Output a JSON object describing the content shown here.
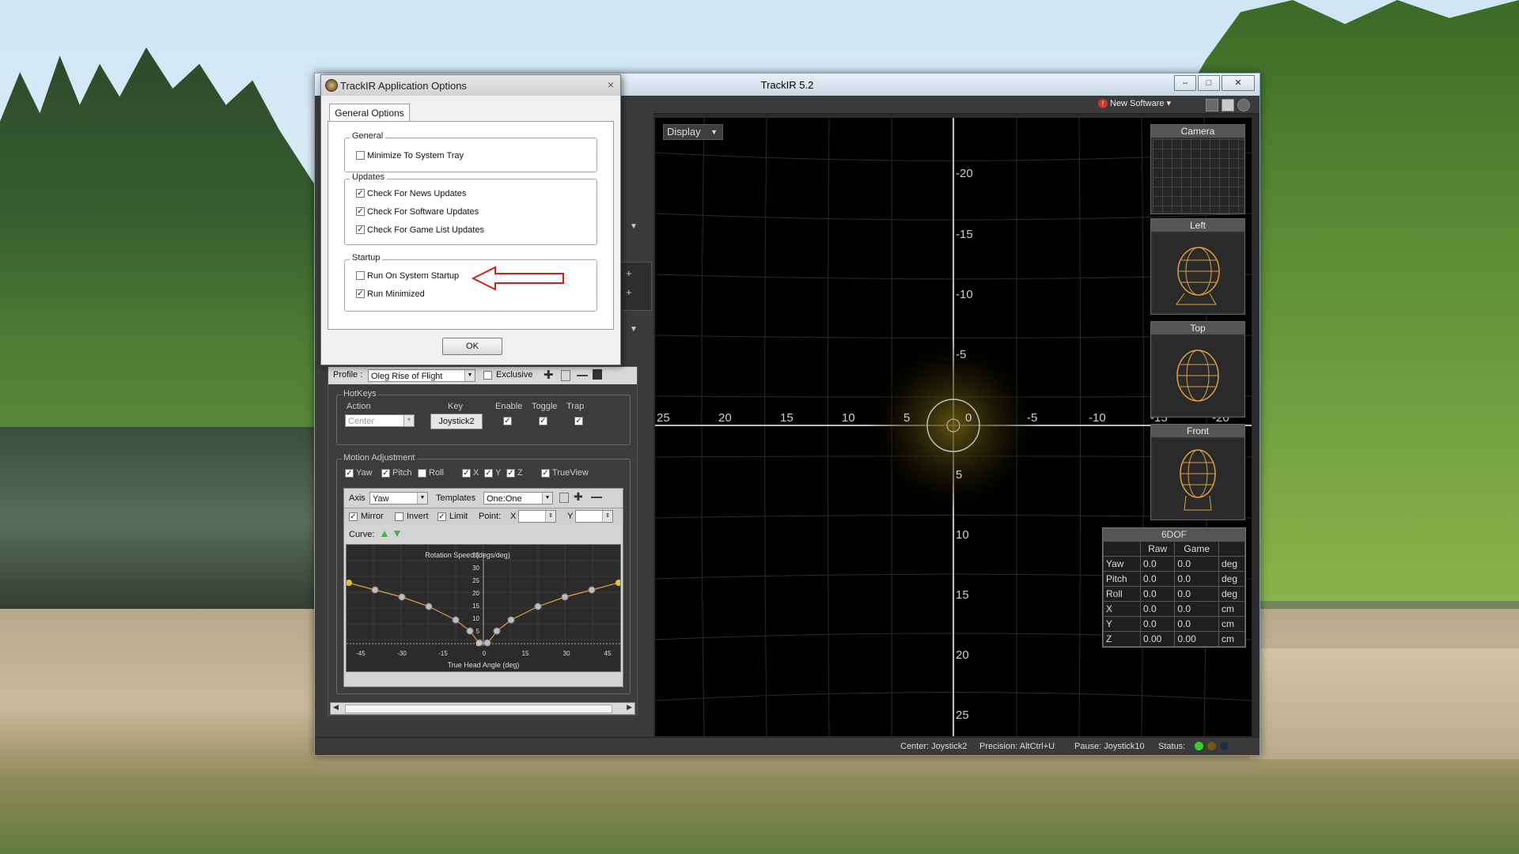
{
  "main_window": {
    "title": "TrackIR 5.2",
    "new_software": "New Software",
    "display_button": "Display",
    "minimize_glyph": "–",
    "maximize_glyph": "□",
    "close_glyph": "✕"
  },
  "view": {
    "x_ticks": [
      "25",
      "20",
      "15",
      "10",
      "5",
      "0",
      "-5",
      "-10",
      "-15",
      "-20"
    ],
    "y_ticks": [
      "-20",
      "-15",
      "-10",
      "-5",
      "5",
      "10",
      "15",
      "20",
      "25"
    ]
  },
  "panels": {
    "camera": "Camera",
    "left": "Left",
    "top": "Top",
    "front": "Front"
  },
  "sixdof": {
    "title": "6DOF",
    "col_raw": "Raw",
    "col_game": "Game",
    "rows": [
      {
        "axis": "Yaw",
        "raw": "0.0",
        "game": "0.0",
        "unit": "deg"
      },
      {
        "axis": "Pitch",
        "raw": "0.0",
        "game": "0.0",
        "unit": "deg"
      },
      {
        "axis": "Roll",
        "raw": "0.0",
        "game": "0.0",
        "unit": "deg"
      },
      {
        "axis": "X",
        "raw": "0.0",
        "game": "0.0",
        "unit": "cm"
      },
      {
        "axis": "Y",
        "raw": "0.0",
        "game": "0.0",
        "unit": "cm"
      },
      {
        "axis": "Z",
        "raw": "0.00",
        "game": "0.00",
        "unit": "cm"
      }
    ]
  },
  "status": {
    "center": "Center: Joystick2",
    "precision": "Precision: AltCtrl+U",
    "pause": "Pause: Joystick10",
    "status": "Status:"
  },
  "profile": {
    "label": "Profile :",
    "value": "Oleg Rise of Flight",
    "exclusive": "Exclusive",
    "hotkeys": {
      "group": "HotKeys",
      "col_action": "Action",
      "col_key": "Key",
      "col_enable": "Enable",
      "col_toggle": "Toggle",
      "col_trap": "Trap",
      "action": "Center",
      "key": "Joystick2"
    },
    "motion": {
      "group": "Motion Adjustment",
      "yaw": "Yaw",
      "pitch": "Pitch",
      "roll": "Roll",
      "x": "X",
      "y": "Y",
      "z": "Z",
      "trueview": "TrueView",
      "axis_label": "Axis",
      "axis_value": "Yaw",
      "templates_label": "Templates",
      "templates_value": "One:One",
      "mirror": "Mirror",
      "invert": "Invert",
      "limit": "Limit",
      "point_label": "Point:",
      "point_x": "X",
      "point_y": "Y",
      "curve_label": "Curve:"
    },
    "graph": {
      "title": "Rotation Speed (degs/deg)",
      "xlabel": "True Head Angle (deg)",
      "y_ticks": [
        "35",
        "30",
        "25",
        "20",
        "15",
        "10",
        "5",
        "0"
      ],
      "x_ticks": [
        "-45",
        "-30",
        "-15",
        "0",
        "15",
        "30",
        "45"
      ]
    }
  },
  "options_dialog": {
    "title": "TrackIR Application Options",
    "close_glyph": "×",
    "tab": "General Options",
    "general": {
      "label": "General",
      "minimize_tray": "Minimize To System Tray",
      "minimize_tray_checked": false
    },
    "updates": {
      "label": "Updates",
      "news": "Check For News Updates",
      "software": "Check For Software Updates",
      "gamelist": "Check For Game List Updates"
    },
    "startup": {
      "label": "Startup",
      "run_on_startup": "Run On System Startup",
      "run_minimized": "Run Minimized"
    },
    "ok": "OK"
  },
  "colors": {
    "arrow": "#d21c1c",
    "accent_yellow": "#d8b62a",
    "curve_orange": "#e0a040"
  }
}
